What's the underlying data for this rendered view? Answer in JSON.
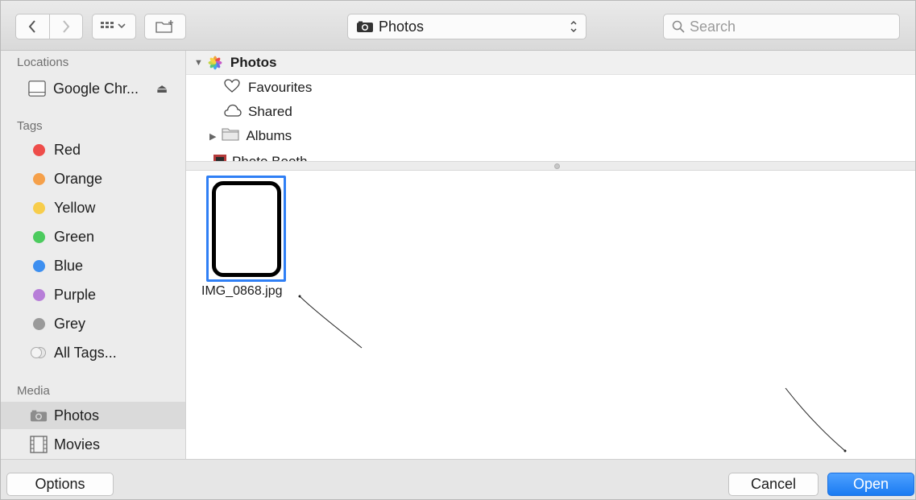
{
  "toolbar": {
    "location": "Photos",
    "search_placeholder": "Search"
  },
  "sidebar": {
    "locations_header": "Locations",
    "device_label": "Google Chr...",
    "tags_header": "Tags",
    "tags": [
      {
        "label": "Red",
        "color": "#ee4d4a"
      },
      {
        "label": "Orange",
        "color": "#f5a04a"
      },
      {
        "label": "Yellow",
        "color": "#f7cd4b"
      },
      {
        "label": "Green",
        "color": "#4ccb5e"
      },
      {
        "label": "Blue",
        "color": "#3d8ff0"
      },
      {
        "label": "Purple",
        "color": "#b77ed8"
      },
      {
        "label": "Grey",
        "color": "#9a9a9a"
      }
    ],
    "all_tags": "All Tags...",
    "media_header": "Media",
    "media": [
      {
        "label": "Photos",
        "icon": "camera-icon",
        "selected": true
      },
      {
        "label": "Movies",
        "icon": "film-icon",
        "selected": false
      }
    ]
  },
  "outline": {
    "root": "Photos",
    "items": [
      "Favourites",
      "Shared",
      "Albums",
      "Photo Booth"
    ]
  },
  "browser": {
    "file_name": "IMG_0868.jpg"
  },
  "footer": {
    "options": "Options",
    "cancel": "Cancel",
    "open": "Open"
  },
  "colors": {
    "accent": "#1a7bf2",
    "selection": "#2f7ff5"
  }
}
